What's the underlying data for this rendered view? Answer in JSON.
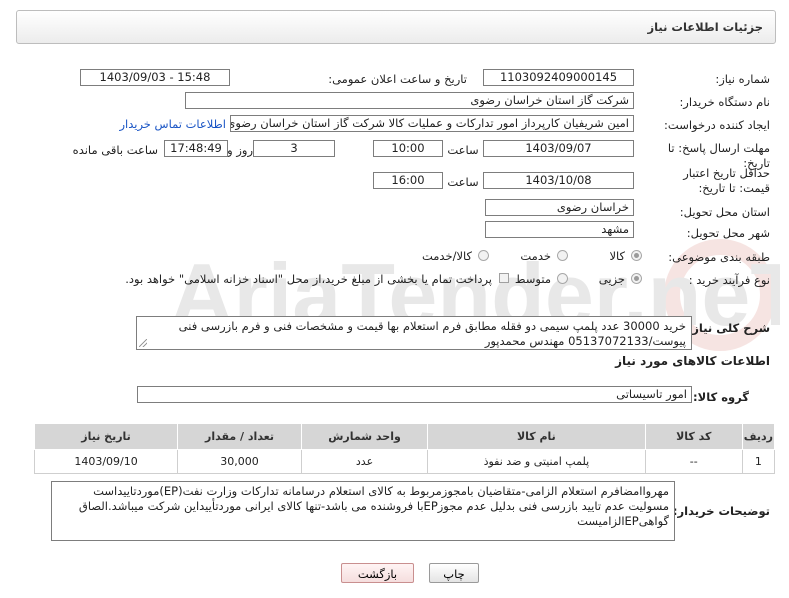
{
  "header": {
    "title": "جزئیات اطلاعات نیاز"
  },
  "fields": {
    "need_number": {
      "label": "شماره نیاز:",
      "value": "1103092409000145"
    },
    "announce_datetime": {
      "label": "تاریخ و ساعت اعلان عمومی:",
      "value": "1403/09/03 - 15:48"
    },
    "buyer_org": {
      "label": "نام دستگاه خریدار:",
      "value": "شرکت گاز استان خراسان رضوی"
    },
    "requester": {
      "label": "ایجاد کننده درخواست:",
      "value": "امین شریفیان کارپرداز امور تدارکات و عملیات کالا شرکت گاز استان خراسان رضوی",
      "contact_link": "اطلاعات تماس خریدار"
    },
    "reply_deadline": {
      "label": "مهلت ارسال پاسخ: تا تاریخ:",
      "date": "1403/09/07",
      "time_label": "ساعت",
      "time": "10:00",
      "days": "3",
      "days_label": "روز و",
      "remaining": "17:48:49",
      "remaining_label": "ساعت باقی مانده"
    },
    "price_validity": {
      "label": "حداقل تاریخ اعتبار قیمت: تا تاریخ:",
      "date": "1403/10/08",
      "time_label": "ساعت",
      "time": "16:00"
    },
    "delivery_province": {
      "label": "استان محل تحویل:",
      "value": "خراسان رضوی"
    },
    "delivery_city": {
      "label": "شهر محل تحویل:",
      "value": "مشهد"
    },
    "category": {
      "label": "طبقه بندی موضوعی:",
      "options": [
        "کالا",
        "خدمت",
        "کالا/خدمت"
      ],
      "selected": "کالا"
    },
    "purchase_type": {
      "label": "نوع فرآیند خرید :",
      "options": [
        "جزیی",
        "متوسط"
      ],
      "selected": "جزیی",
      "payment_note": "پرداخت تمام یا بخشی از مبلغ خرید،از محل \"اسناد خزانه اسلامی\" خواهد بود."
    }
  },
  "description": {
    "label": "شرح کلی نیاز:",
    "text": "خرید 30000 عدد پلمپ سیمی دو فقله مطابق فرم استعلام بها قیمت و مشخصات فنی و فرم بازرسی فنی پیوست/05137072133 مهندس محمدپور"
  },
  "goods_section": {
    "title": "اطلاعات کالاهای مورد نیاز"
  },
  "goods_group": {
    "label": "گروه کالا:",
    "value": "امور تاسیساتی"
  },
  "table": {
    "headers": [
      "ردیف",
      "کد کالا",
      "نام کالا",
      "واحد شمارش",
      "تعداد / مقدار",
      "تاریخ نیاز"
    ],
    "rows": [
      [
        "1",
        "--",
        "پلمپ امنیتی و ضد نفوذ",
        "عدد",
        "30,000",
        "1403/09/10"
      ]
    ]
  },
  "buyer_notes": {
    "label": "توضیحات خریدار:",
    "text": "مهرواامضافرم استعلام الزامی-متقاضیان بامجوزمربوط به کالای استعلام درسامانه تدارکات وزارت نفت(EP)موردتاییداست مسولیت عدم تایید بازرسی فنی بدلیل عدم مجوزEPبا فروشنده می باشد-تنها کالای ایرانی موردتأییداین شرکت میباشد.الصاق گواهیEPالزامیست"
  },
  "buttons": {
    "print": "چاپ",
    "back": "بازگشت"
  },
  "watermark": {
    "text": "AriaTender.neT"
  }
}
